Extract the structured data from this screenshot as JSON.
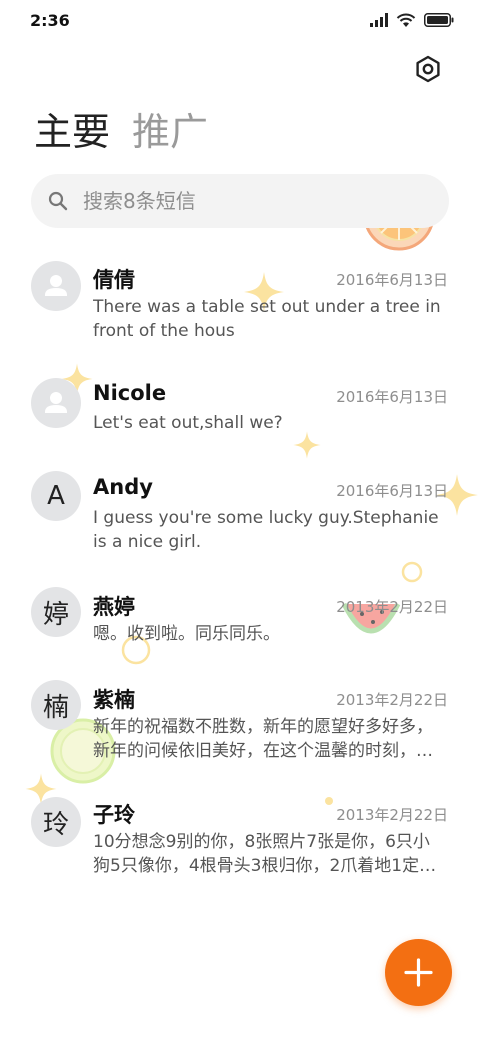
{
  "status_bar": {
    "time": "2:36"
  },
  "tabs": [
    {
      "label": "主要",
      "active": true
    },
    {
      "label": "推广",
      "active": false
    }
  ],
  "search": {
    "placeholder": "搜索8条短信"
  },
  "conversations": [
    {
      "name": "倩倩",
      "avatar": "person-icon",
      "date": "2016年6月13日",
      "preview_lines": [
        "There was a table set out under a tree in",
        "front of the hous"
      ]
    },
    {
      "name": "Nicole",
      "avatar": "person-icon",
      "date": "2016年6月13日",
      "preview_lines": [
        "Let's eat out,shall we?"
      ]
    },
    {
      "name": "Andy",
      "avatar_letter": "A",
      "date": "2016年6月13日",
      "preview_lines": [
        "I guess you're some lucky guy.Stephanie",
        "is a nice girl."
      ]
    },
    {
      "name": "燕婷",
      "avatar_letter": "婷",
      "date": "2013年2月22日",
      "preview_lines": [
        "嗯。收到啦。同乐同乐。"
      ]
    },
    {
      "name": "紫楠",
      "avatar_letter": "楠",
      "date": "2013年2月22日",
      "preview_lines": [
        "新年的祝福数不胜数，新年的愿望好多好多，",
        "新年的问候依旧美好，在这个温馨的时刻，…"
      ]
    },
    {
      "name": "子玲",
      "avatar_letter": "玲",
      "date": "2013年2月22日",
      "preview_lines": [
        "10分想念9别的你，8张照片7张是你，6只小",
        "狗5只像你，4根骨头3根归你，2爪着地1定…"
      ]
    }
  ],
  "colors": {
    "accent": "#f36f12",
    "search_bg": "#f3f3f3",
    "avatar_bg": "#e3e4e6"
  }
}
